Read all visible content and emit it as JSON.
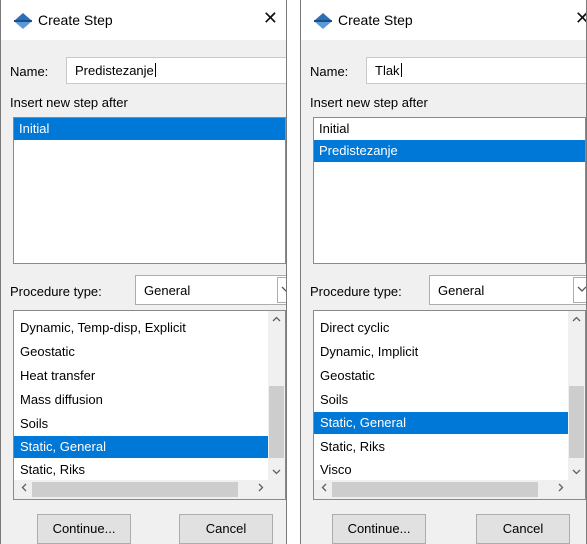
{
  "dialogs": [
    {
      "title": "Create Step",
      "close_symbol": "✕",
      "name_label": "Name:",
      "name_value": "Predistezanje",
      "insert_label": "Insert new step after",
      "steps": [
        "Initial"
      ],
      "selected_step": "Initial",
      "procedure_label": "Procedure type:",
      "procedure_type": "General",
      "procedures": [
        "Dynamic, Temp-disp, Explicit",
        "Geostatic",
        "Heat transfer",
        "Mass diffusion",
        "Soils",
        "Static, General",
        "Static, Riks"
      ],
      "selected_procedure": "Static, General",
      "continue_label": "Continue...",
      "cancel_label": "Cancel"
    },
    {
      "title": "Create Step",
      "close_symbol": "✕",
      "name_label": "Name:",
      "name_value": "Tlak",
      "insert_label": "Insert new step after",
      "steps": [
        "Initial",
        "Predistezanje"
      ],
      "selected_step": "Predistezanje",
      "procedure_label": "Procedure type:",
      "procedure_type": "General",
      "procedures": [
        "Direct cyclic",
        "Dynamic, Implicit",
        "Geostatic",
        "Soils",
        "Static, General",
        "Static, Riks",
        "Visco"
      ],
      "selected_procedure": "Static, General",
      "continue_label": "Continue...",
      "cancel_label": "Cancel"
    }
  ],
  "icons": {
    "title": "abaqus-step-icon",
    "close": "close-icon",
    "dropdown": "chevron-down-icon",
    "scroll_up": "scroll-up-arrow-icon",
    "scroll_down": "scroll-down-arrow-icon",
    "scroll_left": "scroll-left-arrow-icon",
    "scroll_right": "scroll-right-arrow-icon"
  },
  "colors": {
    "selection": "#0078d7",
    "dialog_bg": "#f0f0f0",
    "icon_blue": "#2c6fb6"
  }
}
